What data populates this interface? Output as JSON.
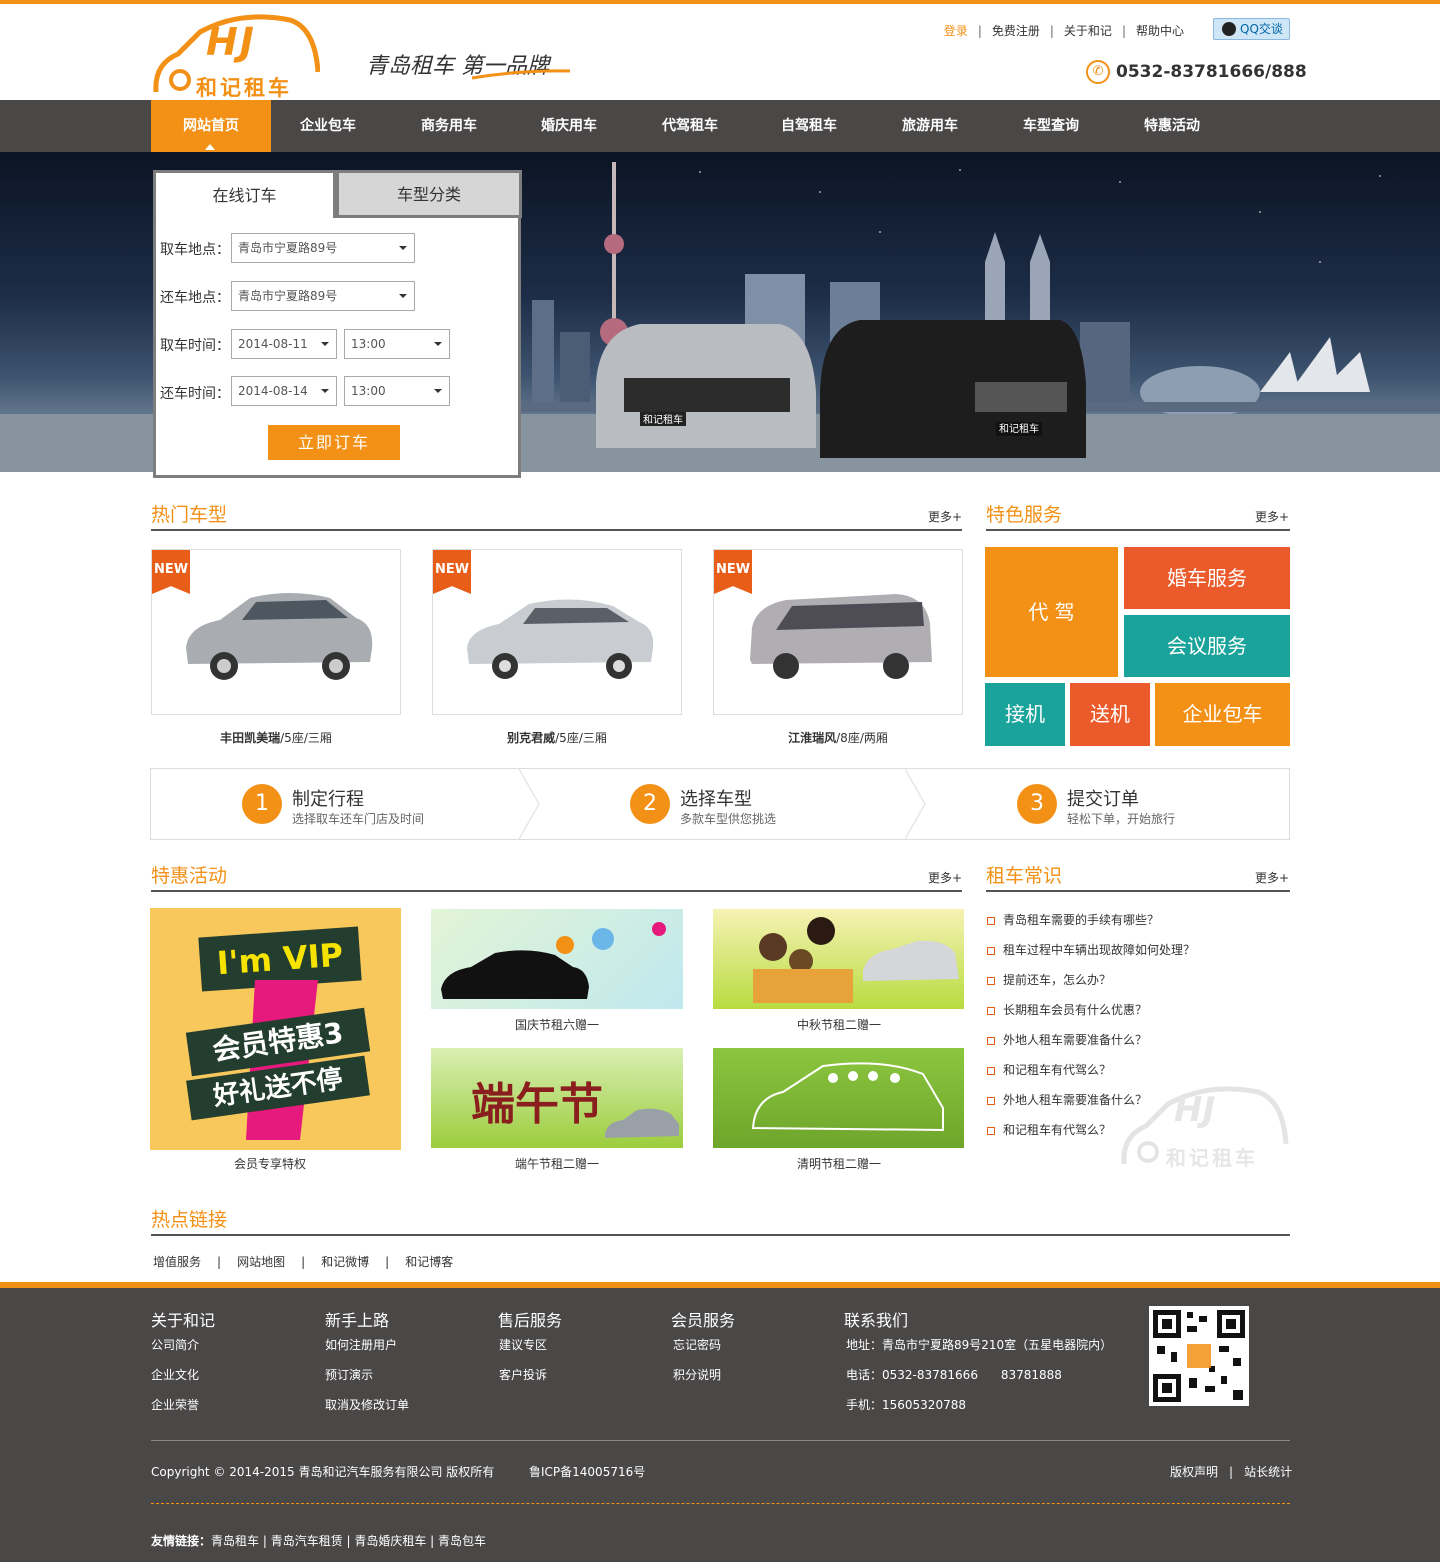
{
  "header": {
    "logo_letters": "HJ",
    "logo_name": "和记租车",
    "slogan": "青岛租车 第一品牌",
    "links": [
      "登录",
      "免费注册",
      "关于和记",
      "帮助中心"
    ],
    "qq_label": "QQ交谈",
    "phone": "0532-83781666/888"
  },
  "nav": {
    "items": [
      "网站首页",
      "企业包车",
      "商务用车",
      "婚庆用车",
      "代驾租车",
      "自驾租车",
      "旅游用车",
      "车型查询",
      "特惠活动"
    ]
  },
  "booking": {
    "tab_online": "在线订车",
    "tab_category": "车型分类",
    "pickup_place_label": "取车地点：",
    "pickup_place_value": "青岛市宁夏路89号",
    "return_place_label": "还车地点：",
    "return_place_value": "青岛市宁夏路89号",
    "pickup_time_label": "取车时间：",
    "pickup_date": "2014-08-11",
    "pickup_hour": "13:00",
    "return_time_label": "还车时间：",
    "return_date": "2014-08-14",
    "return_hour": "13:00",
    "submit": "立即订车",
    "car_badge": "和记租车"
  },
  "hot_cars": {
    "title": "热门车型",
    "more": "更多+",
    "new_tag": "NEW",
    "items": [
      {
        "name": "丰田凯美瑞",
        "spec": "/5座/三厢"
      },
      {
        "name": "别克君威",
        "spec": "/5座/三厢"
      },
      {
        "name": "江淮瑞风",
        "spec": "/8座/两厢"
      }
    ]
  },
  "services": {
    "title": "特色服务",
    "more": "更多+",
    "tiles": [
      "代 驾",
      "婚车服务",
      "会议服务",
      "接机",
      "送机",
      "企业包车"
    ],
    "colors": {
      "orange": "#f39117",
      "red": "#ea5a2a",
      "teal": "#1aa39a"
    }
  },
  "steps": [
    {
      "num": "1",
      "title": "制定行程",
      "sub": "选择取车还车门店及时间"
    },
    {
      "num": "2",
      "title": "选择车型",
      "sub": "多款车型供您挑选"
    },
    {
      "num": "3",
      "title": "提交订单",
      "sub": "轻松下单，开始旅行"
    }
  ],
  "promotions": {
    "title": "特惠活动",
    "more": "更多+",
    "vip_text_top": "I'm VIP",
    "vip_text_mid": "会员特惠3",
    "vip_text_bottom": "好礼送不停",
    "festival_text": "端午节",
    "items": [
      "会员专享特权",
      "国庆节租六赠一",
      "中秋节租二赠一",
      "端午节租二赠一",
      "清明节租二赠一"
    ]
  },
  "tips": {
    "title": "租车常识",
    "more": "更多+",
    "items": [
      "青岛租车需要的手续有哪些？",
      "租车过程中车辆出现故障如何处理？",
      "提前还车，怎么办？",
      "长期租车会员有什么优惠？",
      "外地人租车需要准备什么？",
      "和记租车有代驾么？",
      "外地人租车需要准备什么？",
      "和记租车有代驾么？"
    ]
  },
  "hotlinks": {
    "title": "热点链接",
    "items": [
      "增值服务",
      "网站地图",
      "和记微博",
      "和记博客"
    ]
  },
  "footer": {
    "columns": [
      {
        "head": "关于和记",
        "links": [
          "公司简介",
          "企业文化",
          "企业荣誉"
        ]
      },
      {
        "head": "新手上路",
        "links": [
          "如何注册用户",
          "预订演示",
          "取消及修改订单"
        ]
      },
      {
        "head": "售后服务",
        "links": [
          "建议专区",
          "客户投诉"
        ]
      },
      {
        "head": "会员服务",
        "links": [
          "忘记密码",
          "积分说明"
        ]
      }
    ],
    "contact_head": "联系我们",
    "address": "地址：青岛市宁夏路89号210室（五星电器院内）",
    "tel": "电话：0532-83781666      83781888",
    "mobile": "手机：15605320788",
    "copyright": "Copyright © 2014-2015 青岛和记汽车服务有限公司 版权所有",
    "icp": "鲁ICP备14005716号",
    "right_links": [
      "版权声明",
      "站长统计"
    ],
    "friend_label": "友情链接：",
    "friend_links": "青岛租车 | 青岛汽车租赁 | 青岛婚庆租车 | 青岛包车"
  }
}
